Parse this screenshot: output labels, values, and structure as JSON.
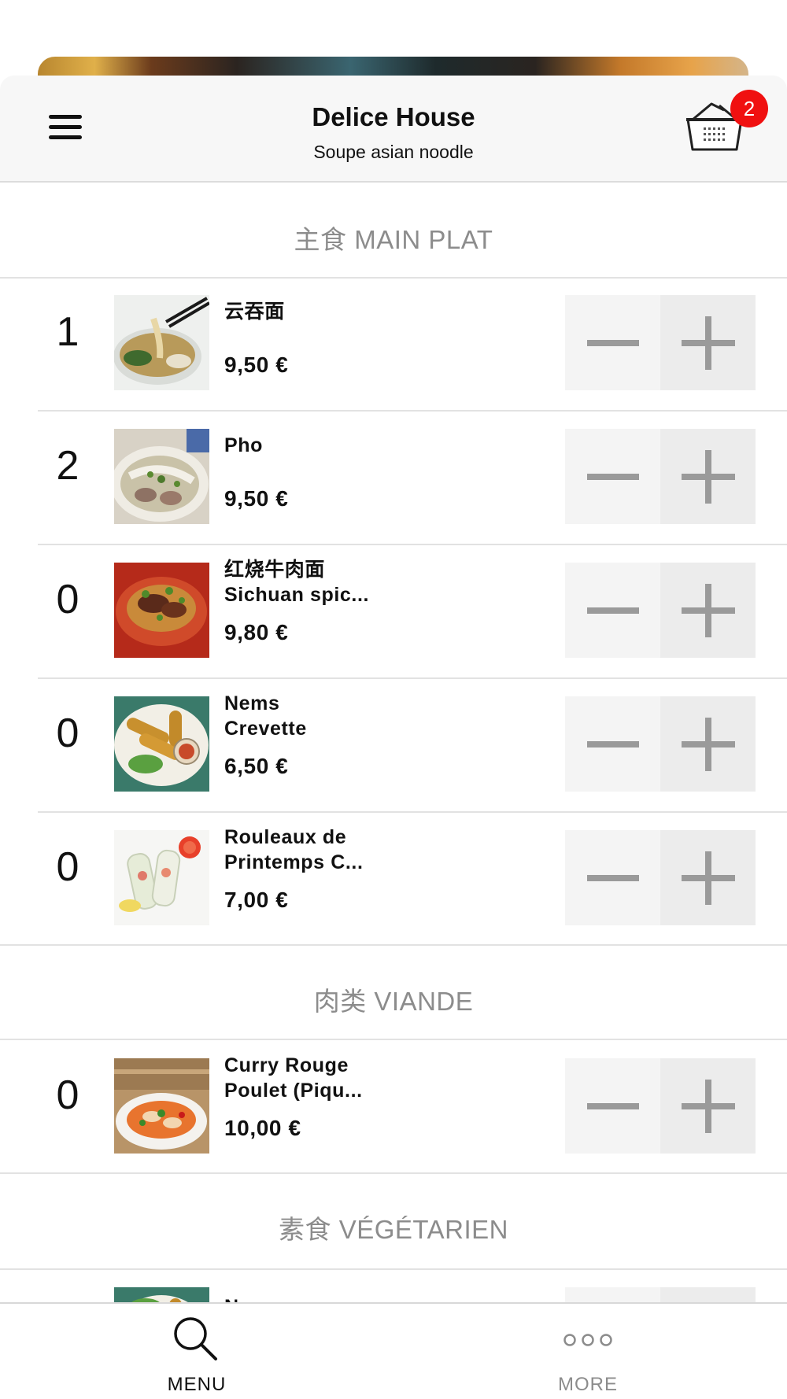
{
  "header": {
    "title": "Delice House",
    "subtitle": "Soupe asian noodle",
    "cart_count": "2",
    "menu_icon": "hamburger-menu-icon",
    "cart_icon": "shopping-basket-icon"
  },
  "sections": [
    {
      "title": "主食 MAIN PLAT",
      "items": [
        {
          "qty": "1",
          "name": "云吞面",
          "price": "9,50 €"
        },
        {
          "qty": "2",
          "name": "Pho",
          "price": "9,50 €"
        },
        {
          "qty": "0",
          "name": "红烧牛肉面\nSichuan spic...",
          "price": "9,80 €"
        },
        {
          "qty": "0",
          "name": "Nems\nCrevette",
          "price": "6,50 €"
        },
        {
          "qty": "0",
          "name": "Rouleaux de\nPrintemps C...",
          "price": "7,00 €"
        }
      ]
    },
    {
      "title": "肉类 VIANDE",
      "items": [
        {
          "qty": "0",
          "name": "Curry Rouge\nPoulet (Piqu...",
          "price": "10,00 €"
        }
      ]
    },
    {
      "title": "素食 VÉGÉTARIEN",
      "items": [
        {
          "qty": "",
          "name": "Nems",
          "price": ""
        }
      ]
    }
  ],
  "tabbar": {
    "menu_label": "MENU",
    "more_label": "MORE",
    "menu_icon": "search-icon",
    "more_icon": "more-dots-icon"
  },
  "colors": {
    "badge": "#f01010",
    "section_title": "#8c8c8c",
    "stepper_bg": "#f4f4f4",
    "stepper_icon": "#9a9a9a"
  }
}
